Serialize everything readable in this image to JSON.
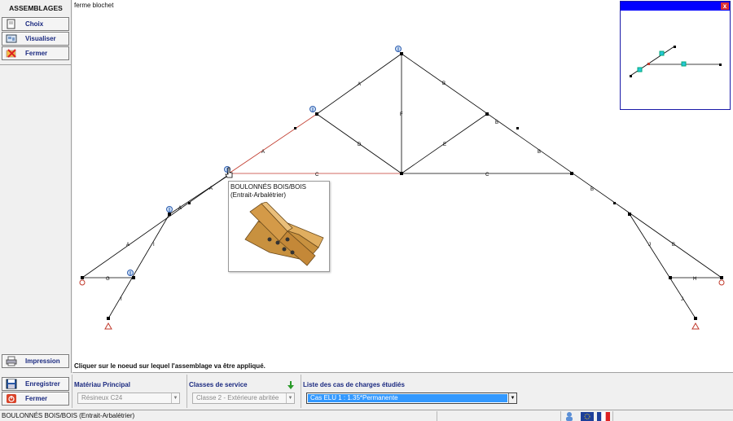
{
  "sidebar": {
    "title": "ASSEMBLAGES",
    "buttons": [
      {
        "label": "Choix",
        "icon": "document-icon"
      },
      {
        "label": "Visualiser",
        "icon": "view-icon"
      },
      {
        "label": "Fermer",
        "icon": "close-icon"
      }
    ],
    "print_label": "Impression"
  },
  "canvas": {
    "document_title": "ferme blochet",
    "hint": "Cliquer sur le noeud sur lequel l'assemblage va être appliqué.",
    "member_labels": [
      "A",
      "A",
      "A",
      "A",
      "A",
      "B",
      "B",
      "B",
      "B",
      "B",
      "C",
      "C",
      "D",
      "E",
      "F",
      "G",
      "H",
      "I",
      "I",
      "J",
      "J"
    ],
    "tooltip": {
      "title": "BOULONNÉS BOIS/BOIS",
      "subtitle": "(Entrait-Arbalétrier)"
    },
    "minimap_close": "x"
  },
  "bottom": {
    "save_label": "Enregistrer",
    "close_label": "Fermer",
    "material": {
      "label": "Matériau Principal",
      "value": "Résineux C24"
    },
    "service_class": {
      "label": "Classes de service",
      "value": "Classe 2 - Extérieure abritée"
    },
    "load_cases": {
      "label": "Liste des cas de charges étudiés",
      "value": "Cas ELU 1 :  1.35*Permanente"
    }
  },
  "status": {
    "text": "BOULONNÉS BOIS/BOIS (Entrait-Arbalétrier)"
  },
  "colors": {
    "accent": "#1b2a80",
    "selection": "#3399ff",
    "highlight_member": "#c0392b",
    "minimap_titlebar": "#0000ff"
  }
}
